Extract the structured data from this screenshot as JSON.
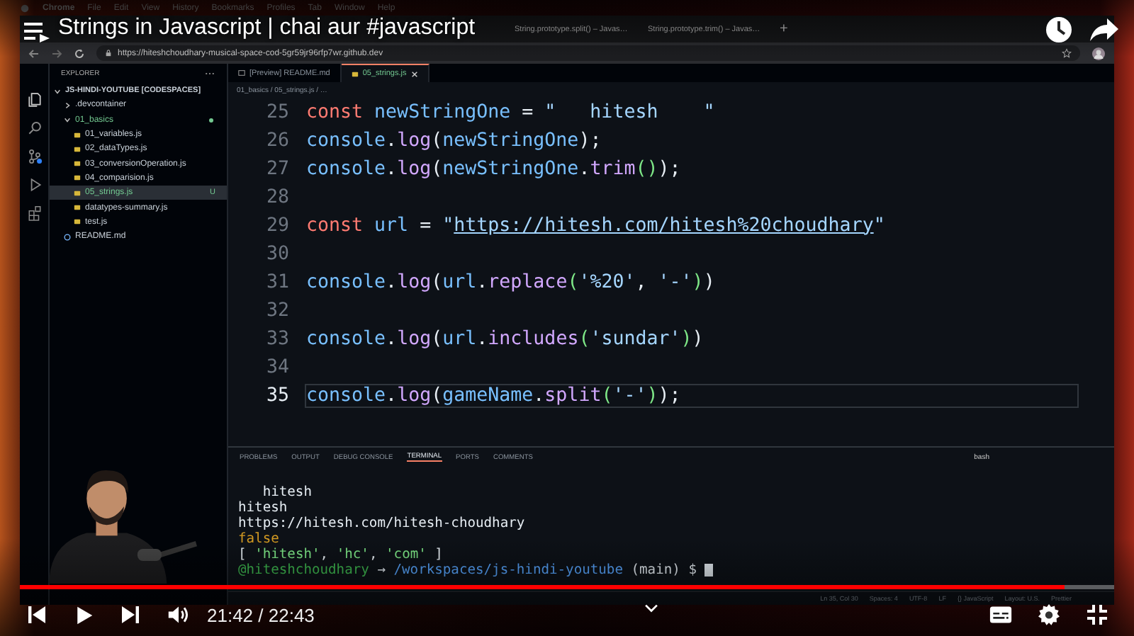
{
  "player": {
    "title": "Strings in Javascript | chai aur #javascript",
    "time": "21:42 / 22:43",
    "progress": {
      "level": 0.955
    }
  },
  "menu_bar": [
    "Chrome",
    "File",
    "Edit",
    "View",
    "History",
    "Bookmarks",
    "Profiles",
    "Tab",
    "Window",
    "Help"
  ],
  "browser": {
    "tabs": [
      {
        "label": "String.prototype.split() – Javas…",
        "selected": false
      },
      {
        "label": "String.prototype.trim() – Javas…",
        "selected": false
      }
    ],
    "new_tab": "+",
    "address": "https://hiteshchoudhary-musical-space-cod-5gr59jr96rfp7wr.github.dev"
  },
  "vscode": {
    "explorer": {
      "title": "EXPLORER",
      "tree": [
        {
          "label": "JS-HINDI-YOUTUBE [CODESPACES]",
          "kind": "root",
          "expanded": true,
          "selected": false,
          "children": [
            {
              "label": ".devcontainer",
              "kind": "folder",
              "expanded": false,
              "selected": false
            },
            {
              "label": "01_basics",
              "kind": "folder",
              "expanded": true,
              "selected": false,
              "untracked": true,
              "children": [
                {
                  "label": "01_variables.js",
                  "kind": "js",
                  "selected": false
                },
                {
                  "label": "02_dataTypes.js",
                  "kind": "js",
                  "selected": false
                },
                {
                  "label": "03_conversionOperation.js",
                  "kind": "js",
                  "selected": false
                },
                {
                  "label": "04_comparision.js",
                  "kind": "js",
                  "selected": false
                },
                {
                  "label": "05_strings.js",
                  "kind": "js",
                  "selected": true,
                  "untracked": true,
                  "badge": "U"
                },
                {
                  "label": "datatypes-summary.js",
                  "kind": "js",
                  "selected": false
                },
                {
                  "label": "test.js",
                  "kind": "js",
                  "selected": false
                }
              ]
            },
            {
              "label": "README.md",
              "kind": "info",
              "selected": false
            }
          ]
        }
      ]
    },
    "tabs": [
      {
        "label": "[Preview] README.md",
        "kind": "preview",
        "selected": false
      },
      {
        "label": "05_strings.js",
        "kind": "js",
        "selected": true
      }
    ],
    "breadcrumb": "01_basics / 05_strings.js / …",
    "lines": [
      {
        "number": "25",
        "active": false,
        "tokens": [
          {
            "text": "const ",
            "kind": "keyword"
          },
          {
            "text": "newStringOne",
            "kind": "var"
          },
          {
            "text": " = ",
            "kind": "punct"
          },
          {
            "text": "\"   hitesh    \"",
            "kind": "str"
          }
        ]
      },
      {
        "number": "26",
        "active": false,
        "tokens": [
          {
            "text": "console",
            "kind": "var"
          },
          {
            "text": ".",
            "kind": "punct"
          },
          {
            "text": "log",
            "kind": "fn"
          },
          {
            "text": "(",
            "kind": "punct"
          },
          {
            "text": "newStringOne",
            "kind": "var"
          },
          {
            "text": ");",
            "kind": "punct"
          }
        ]
      },
      {
        "number": "27",
        "active": false,
        "tokens": [
          {
            "text": "console",
            "kind": "var"
          },
          {
            "text": ".",
            "kind": "punct"
          },
          {
            "text": "log",
            "kind": "fn"
          },
          {
            "text": "(",
            "kind": "punct"
          },
          {
            "text": "newStringOne",
            "kind": "var"
          },
          {
            "text": ".",
            "kind": "punct"
          },
          {
            "text": "trim",
            "kind": "fn"
          },
          {
            "text": "()",
            "kind": "paren"
          },
          {
            "text": ");",
            "kind": "punct"
          }
        ]
      },
      {
        "number": "28",
        "active": false
      },
      {
        "number": "29",
        "active": false,
        "tokens": [
          {
            "text": "const ",
            "kind": "keyword"
          },
          {
            "text": "url",
            "kind": "var"
          },
          {
            "text": " = ",
            "kind": "punct"
          },
          {
            "text": "\"",
            "kind": "str"
          },
          {
            "text": "https://hitesh.com/hitesh%20choudhary",
            "kind": "link"
          },
          {
            "text": "\"",
            "kind": "str"
          }
        ]
      },
      {
        "number": "30",
        "active": false
      },
      {
        "number": "31",
        "active": false,
        "tokens": [
          {
            "text": "console",
            "kind": "var"
          },
          {
            "text": ".",
            "kind": "punct"
          },
          {
            "text": "log",
            "kind": "fn"
          },
          {
            "text": "(",
            "kind": "punct"
          },
          {
            "text": "url",
            "kind": "var"
          },
          {
            "text": ".",
            "kind": "punct"
          },
          {
            "text": "replace",
            "kind": "fn"
          },
          {
            "text": "(",
            "kind": "paren"
          },
          {
            "text": "'%20'",
            "kind": "str"
          },
          {
            "text": ", ",
            "kind": "punct"
          },
          {
            "text": "'-'",
            "kind": "str"
          },
          {
            "text": ")",
            "kind": "paren"
          },
          {
            "text": ")",
            "kind": "punct"
          }
        ]
      },
      {
        "number": "32",
        "active": false
      },
      {
        "number": "33",
        "active": false,
        "tokens": [
          {
            "text": "console",
            "kind": "var"
          },
          {
            "text": ".",
            "kind": "punct"
          },
          {
            "text": "log",
            "kind": "fn"
          },
          {
            "text": "(",
            "kind": "punct"
          },
          {
            "text": "url",
            "kind": "var"
          },
          {
            "text": ".",
            "kind": "punct"
          },
          {
            "text": "includes",
            "kind": "fn"
          },
          {
            "text": "(",
            "kind": "paren"
          },
          {
            "text": "'sundar'",
            "kind": "str"
          },
          {
            "text": ")",
            "kind": "paren"
          },
          {
            "text": ")",
            "kind": "punct"
          }
        ]
      },
      {
        "number": "34",
        "active": false
      },
      {
        "number": "35",
        "active": true,
        "tokens": [
          {
            "text": "console",
            "kind": "var"
          },
          {
            "text": ".",
            "kind": "punct"
          },
          {
            "text": "log",
            "kind": "fn"
          },
          {
            "text": "(",
            "kind": "punct"
          },
          {
            "text": "gameName",
            "kind": "var"
          },
          {
            "text": ".",
            "kind": "punct"
          },
          {
            "text": "split",
            "kind": "fn"
          },
          {
            "text": "(",
            "kind": "paren"
          },
          {
            "text": "'-'",
            "kind": "str"
          },
          {
            "text": ")",
            "kind": "paren"
          },
          {
            "text": ");",
            "kind": "punct"
          }
        ]
      }
    ],
    "panel_tabs": [
      {
        "label": "PROBLEMS",
        "selected": false
      },
      {
        "label": "OUTPUT",
        "selected": false
      },
      {
        "label": "DEBUG CONSOLE",
        "selected": false
      },
      {
        "label": "TERMINAL",
        "selected": true
      },
      {
        "label": "PORTS",
        "selected": false
      },
      {
        "label": "COMMENTS",
        "selected": false
      }
    ],
    "shell": "bash",
    "terminal": {
      "cursor": true,
      "lines": [
        {
          "tokens": [
            {
              "text": "   hitesh",
              "kind": "plain"
            }
          ]
        },
        {
          "tokens": [
            {
              "text": "hitesh",
              "kind": "plain"
            }
          ]
        },
        {
          "tokens": [
            {
              "text": "https://hitesh.com/hitesh-choudhary",
              "kind": "plain"
            }
          ]
        },
        {
          "tokens": [
            {
              "text": "false",
              "kind": "bool"
            }
          ]
        },
        {
          "tokens": [
            {
              "text": "[ ",
              "kind": "plain"
            },
            {
              "text": "'hitesh'",
              "kind": "str"
            },
            {
              "text": ", ",
              "kind": "plain"
            },
            {
              "text": "'hc'",
              "kind": "str"
            },
            {
              "text": ", ",
              "kind": "plain"
            },
            {
              "text": "'com'",
              "kind": "str"
            },
            {
              "text": " ]",
              "kind": "plain"
            }
          ]
        },
        {
          "tokens": [
            {
              "text": "@hiteshchoudhary",
              "kind": "user"
            },
            {
              "text": " → ",
              "kind": "plain"
            },
            {
              "text": "/workspaces/js-hindi-youtube",
              "kind": "path"
            },
            {
              "text": " (main) $ ",
              "kind": "plain"
            }
          ]
        }
      ]
    },
    "status_bar": [
      "Ln 35, Col 30",
      "Spaces: 4",
      "UTF-8",
      "LF",
      "{} JavaScript",
      "Layout: U.S.",
      "Prettier"
    ]
  }
}
